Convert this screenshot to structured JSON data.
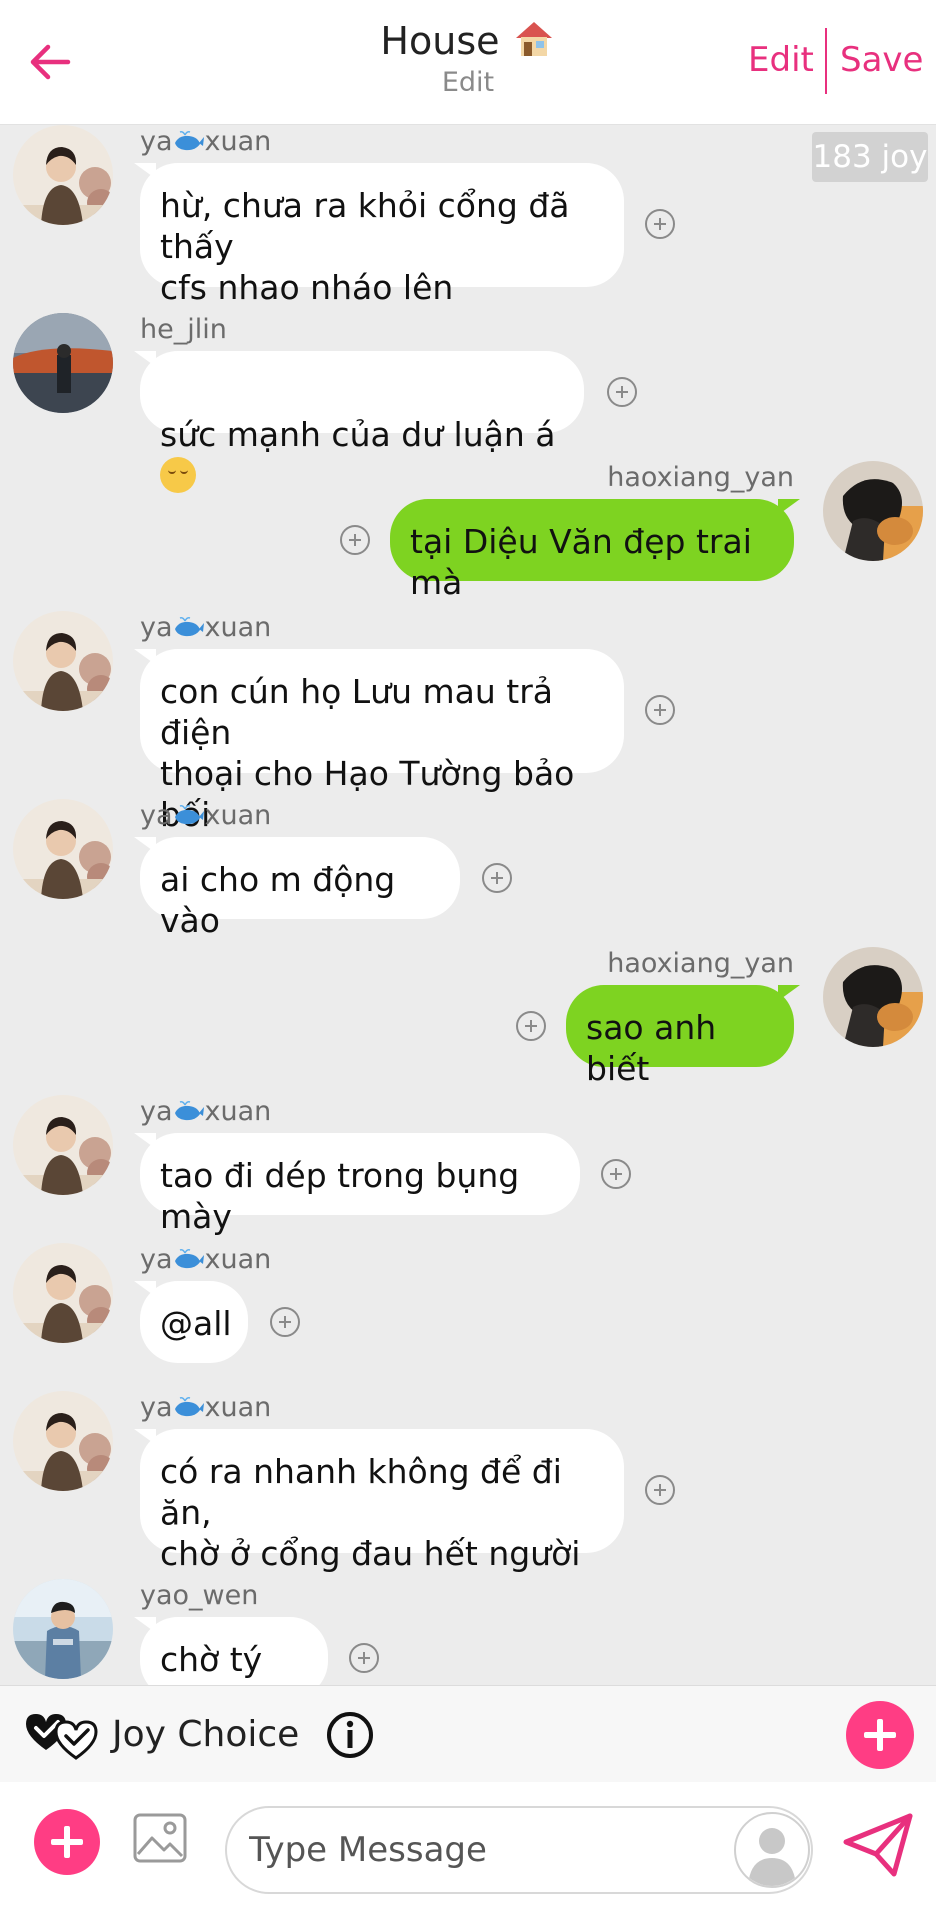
{
  "header": {
    "title": "House",
    "subtitle": "Edit",
    "edit_label": "Edit",
    "save_label": "Save",
    "back_icon": "arrow-left-icon",
    "title_icon": "house-icon"
  },
  "joy_count": "183 joy",
  "colors": {
    "accent": "#e8307e",
    "outgoing_bubble": "#7ed321",
    "incoming_bubble": "#ffffff",
    "background": "#ececec"
  },
  "messages": [
    {
      "user_prefix": "ya",
      "user_suffix": "xuan",
      "text": "hừ, chưa ra khỏi cổng đã thấy\ncfs nhao nháo lên"
    },
    {
      "user": "he_jlin",
      "text": "sức mạnh của dư luận á"
    },
    {
      "user": "haoxiang_yan",
      "text": "tại Diệu Văn đẹp trai mà"
    },
    {
      "user_prefix": "ya",
      "user_suffix": "xuan",
      "text": "con cún họ Lưu mau trả điện\nthoại cho Hạo Tường bảo bối"
    },
    {
      "user_prefix": "ya",
      "user_suffix": "xuan",
      "text": "ai cho m động vào"
    },
    {
      "user": "haoxiang_yan",
      "text": "sao anh biết"
    },
    {
      "user_prefix": "ya",
      "user_suffix": "xuan",
      "text": "tao đi dép trong bụng mày"
    },
    {
      "user_prefix": "ya",
      "user_suffix": "xuan",
      "text": "@all"
    },
    {
      "user_prefix": "ya",
      "user_suffix": "xuan",
      "text": "có ra nhanh không để đi ăn,\nchờ ở cổng đau hết người"
    },
    {
      "user": "yao_wen",
      "text": "chờ tý coi"
    }
  ],
  "joy_choice": {
    "label": "Joy Choice",
    "icon": "double-check-hearts-icon",
    "info_icon": "info-icon",
    "add_icon": "plus-icon"
  },
  "composer": {
    "placeholder": "Type Message",
    "add_icon": "plus-icon",
    "image_icon": "image-icon",
    "avatar_icon": "user-silhouette-icon",
    "send_icon": "send-icon"
  }
}
